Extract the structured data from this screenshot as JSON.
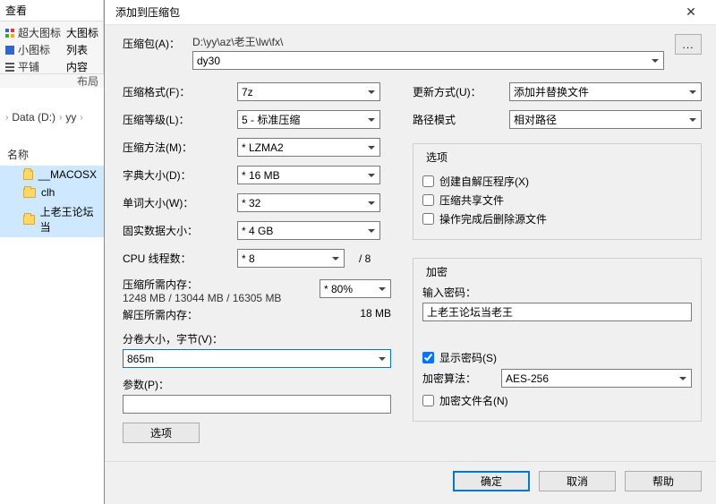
{
  "ribbon": {
    "tab_view": "查看",
    "xl_icons": "超大图标",
    "big_icons": "大图标",
    "small_icons": "小图标",
    "list": "列表",
    "tiles": "平铺",
    "content": "内容",
    "layout_group": "布局"
  },
  "breadcrumb": {
    "drive": "Data (D:)",
    "seg1": "yy"
  },
  "tree": {
    "header": "名称",
    "items": [
      "__MACOSX",
      "clh",
      "上老王论坛当"
    ]
  },
  "dialog": {
    "title": "添加到压缩包",
    "archive_label": "压缩包(A)：",
    "archive_path": "D:\\yy\\az\\老王\\lw\\fx\\",
    "archive_name": "dy30",
    "browse": "...",
    "left": {
      "format_label": "压缩格式(F)：",
      "format": "7z",
      "level_label": "压缩等级(L)：",
      "level": "5 - 标准压缩",
      "method_label": "压缩方法(M)：",
      "method": "* LZMA2",
      "dict_label": "字典大小(D)：",
      "dict": "* 16 MB",
      "word_label": "单词大小(W)：",
      "word": "* 32",
      "solid_label": "固实数据大小：",
      "solid": "* 4 GB",
      "threads_label": "CPU 线程数：",
      "threads": "* 8",
      "threads_max": "/ 8",
      "mem_c_label": "压缩所需内存：",
      "mem_c_detail": "1248 MB / 13044 MB / 16305 MB",
      "mem_pct": "* 80%",
      "mem_d_label": "解压所需内存：",
      "mem_d": "18 MB",
      "vol_label": "分卷大小，字节(V)：",
      "vol": "865m",
      "params_label": "参数(P)：",
      "options_btn": "选项"
    },
    "right": {
      "update_label": "更新方式(U)：",
      "update": "添加并替换文件",
      "pathmode_label": "路径模式",
      "pathmode": "相对路径",
      "options_group": "选项",
      "sfx": "创建自解压程序(X)",
      "shared": "压缩共享文件",
      "delete_after": "操作完成后删除源文件",
      "encrypt_group": "加密",
      "pw_label": "输入密码：",
      "pw_value": "上老王论坛当老王",
      "show_pw": "显示密码(S)",
      "algo_label": "加密算法：",
      "algo": "AES-256",
      "encrypt_names": "加密文件名(N)"
    },
    "buttons": {
      "ok": "确定",
      "cancel": "取消",
      "help": "帮助"
    }
  }
}
